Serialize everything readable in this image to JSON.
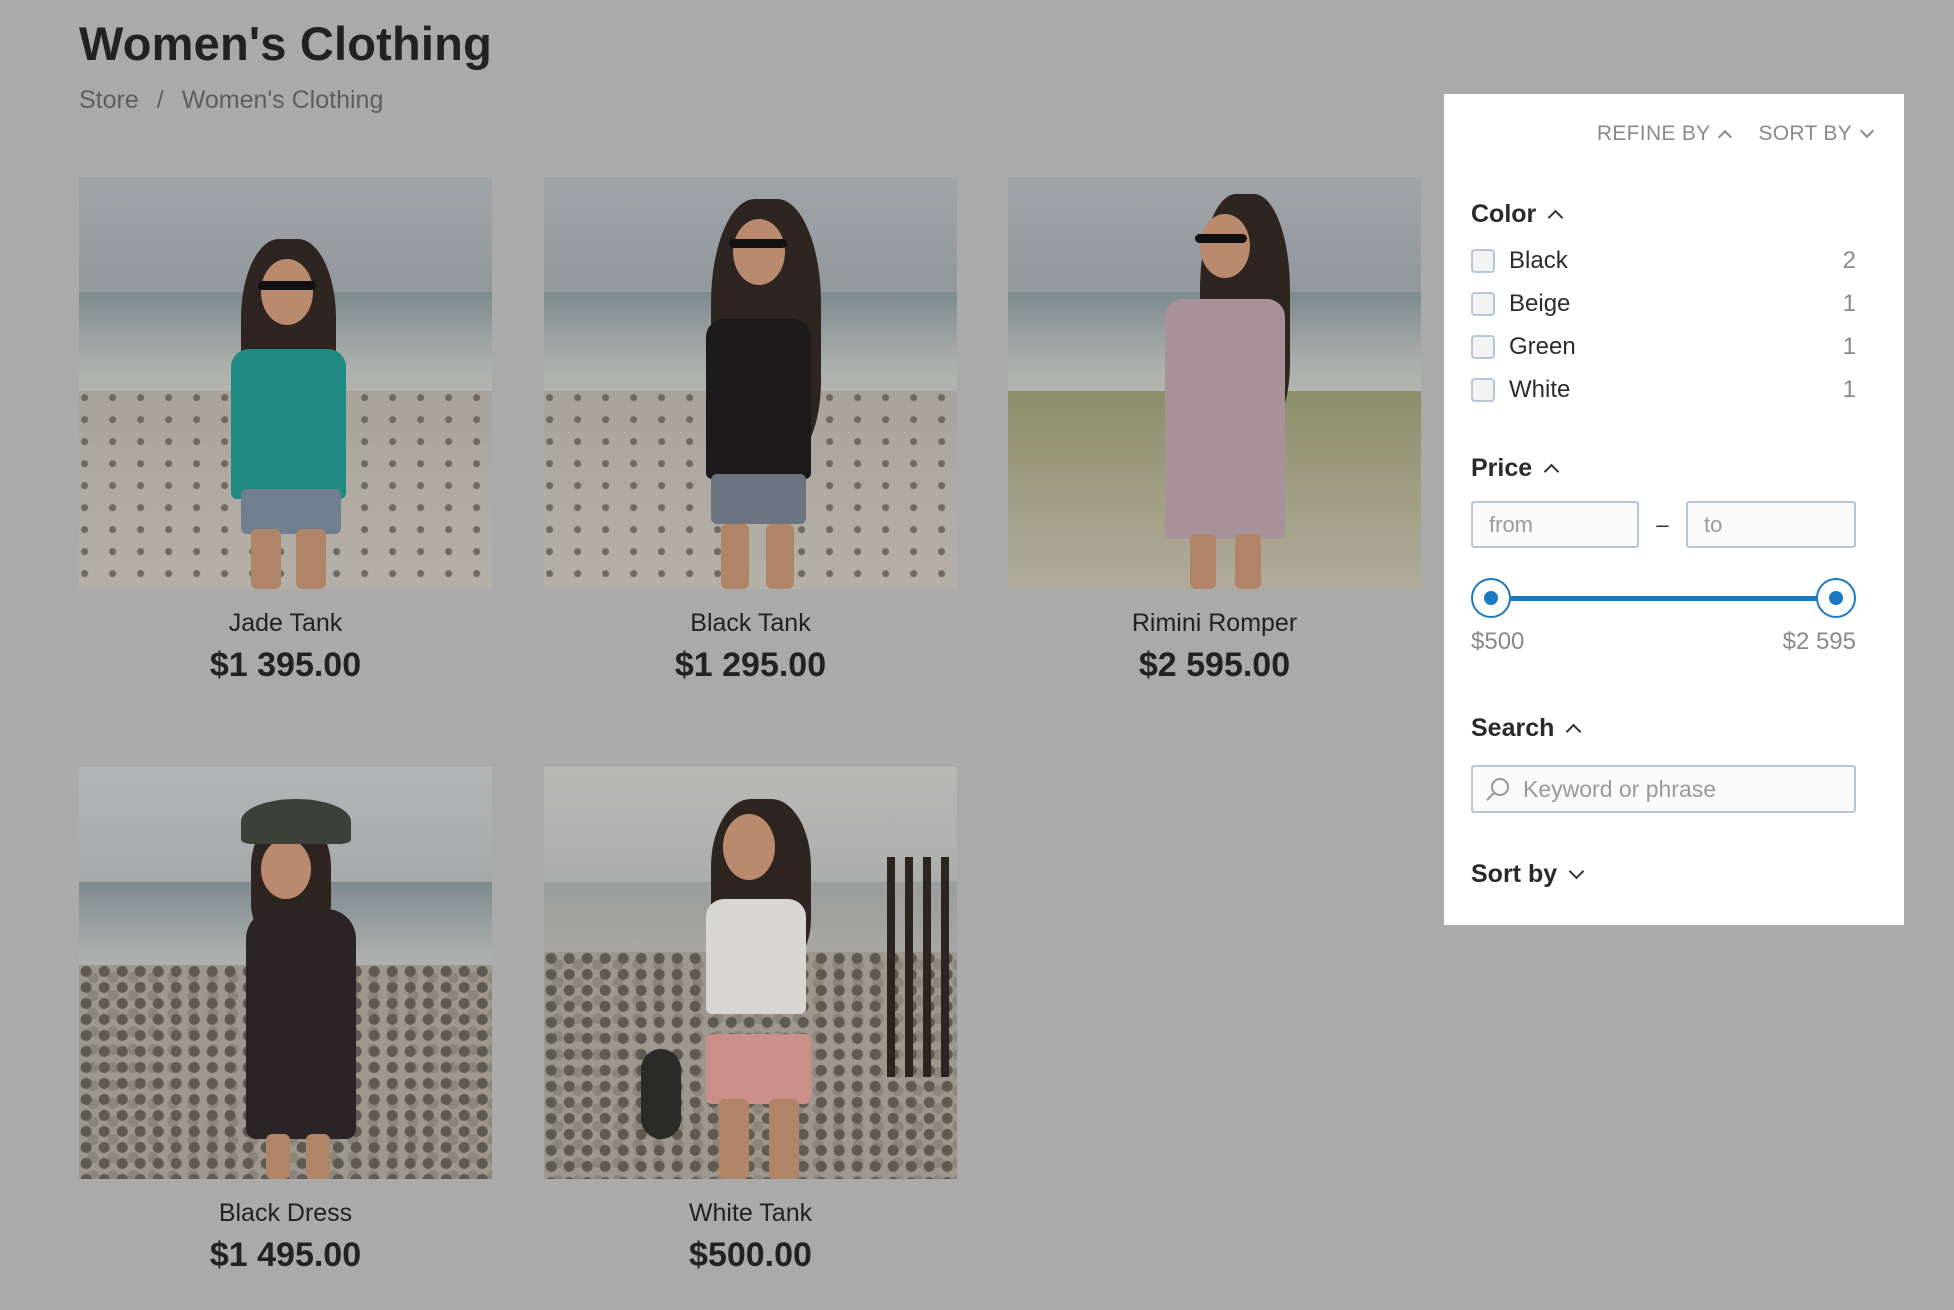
{
  "header": {
    "title": "Women's Clothing",
    "breadcrumb": [
      {
        "label": "Store"
      },
      {
        "label": "/"
      },
      {
        "label": "Women's Clothing"
      }
    ]
  },
  "products": [
    {
      "name": "Jade Tank",
      "price": "$1 395.00",
      "top_color": "#1e8a82",
      "shorts_color": "#6f7f8f",
      "image": "woman-on-beach-jade-tank"
    },
    {
      "name": "Black Tank",
      "price": "$1 295.00",
      "top_color": "#1c1a1a",
      "shorts_color": "#6b7480",
      "image": "woman-on-beach-black-tank"
    },
    {
      "name": "Rimini Romper",
      "price": "$2 595.00",
      "top_color": "#a8929a",
      "shorts_color": "#a8929a",
      "image": "woman-on-beach-romper"
    },
    {
      "name": "Black Dress",
      "price": "$1 495.00",
      "top_color": "#2a2426",
      "shorts_color": "#2a2426",
      "image": "woman-on-beach-black-dress-hat"
    },
    {
      "name": "White Tank",
      "price": "$500.00",
      "top_color": "#d8d6d2",
      "shorts_color": "#c98f88",
      "image": "woman-on-beach-white-tank-skateboard"
    }
  ],
  "panel": {
    "refine_by": "REFINE BY",
    "sort_by": "SORT BY",
    "color": {
      "title": "Color",
      "options": [
        {
          "label": "Black",
          "count": "2",
          "checked": false
        },
        {
          "label": "Beige",
          "count": "1",
          "checked": false
        },
        {
          "label": "Green",
          "count": "1",
          "checked": false
        },
        {
          "label": "White",
          "count": "1",
          "checked": false
        }
      ]
    },
    "price": {
      "title": "Price",
      "from_placeholder": "from",
      "to_placeholder": "to",
      "separator": "–",
      "min_label": "$500",
      "max_label": "$2 595",
      "range_min": 500,
      "range_max": 2595,
      "selected_min": 500,
      "selected_max": 2595,
      "accent": "#1b7ac3"
    },
    "search": {
      "title": "Search",
      "placeholder": "Keyword or phrase",
      "value": ""
    },
    "sort": {
      "title": "Sort by"
    }
  }
}
